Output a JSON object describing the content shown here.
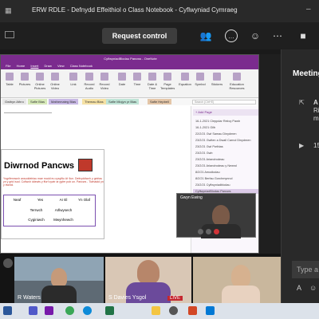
{
  "window": {
    "title": "ERW RDLE - Defnydd Effeithiol o Class Notebook - Cyflwyniad Cymraeg"
  },
  "meeting_bar": {
    "request_control_label": "Request control"
  },
  "onenote": {
    "title_bar": "CyflwyniadBlodau Pancws - OneNote",
    "menu_tabs": [
      "File",
      "Home",
      "Insert",
      "Draw",
      "View",
      "Class Notebook"
    ],
    "ribbon_items": [
      "Table",
      "Pictures",
      "Online Pictures",
      "Online Video",
      "Link",
      "Record Audio",
      "Record Video",
      "Date",
      "Time",
      "Date & Time",
      "Page Templates",
      "Equation",
      "Symbol",
      "Stickers",
      "Education Resources"
    ],
    "section_tabs": [
      "Gwibyn Athro",
      "Safle Blas",
      "Mathemateg Blas",
      "Themau Blas",
      "Safle Mlojyn yr Blas",
      "Safle Hepbell"
    ],
    "search_placeholder": "Search (Ctrl+E)",
    "add_page_label": "+ Add Page",
    "pages": [
      "16-1-2021 Cleppdar Rekvy Pawb",
      "16-1-2021 Gilb",
      "22/2/21 Gwl Samau Dinydmen",
      "23/2/21 Gwlten a Dwall Carnol Dinydmen",
      "23/2/21 Gwl Pwthias",
      "23/2/21 Gwb",
      "23/2/21 Ariandrodeau",
      "23/2/21 Ariandrodeau y Newrol",
      "8/2/21 Amodiodau",
      "8/2/21 Berfau Gorchmynnol",
      "23/2/21 Cyflwyniadblodau",
      "CyflwyniadBlodau Pancws"
    ],
    "doc_heading": "Diwrnod Pancws",
    "doc_text": "Ysgrifennwch ansoddeiriau mae modd eu cysylltu â'r llun. Defnyddiwch y geiriau yn y grid isod. Cofiwch ddewis y ffurf cywir ar gyfer pob un. Pancws - Tiwhaidd yn y bwrdd.",
    "grid": {
      "headers": [
        "",
        "Neaf",
        "Yes",
        "Ar El",
        "Yn Olaf"
      ],
      "rows": [
        [
          "",
          "Terrwch",
          "Arllwysech",
          ""
        ],
        [
          "",
          "Cyginiwch",
          "Mwynhewch",
          ""
        ]
      ]
    }
  },
  "presenter_inset": {
    "name": "Gwyn Ewing"
  },
  "side_panel": {
    "title": "Meeting",
    "items": [
      "A",
      "Ri",
      "m",
      "15"
    ]
  },
  "type_box": {
    "placeholder": "Type a"
  },
  "participants": [
    {
      "name": "R Waters",
      "live": ""
    },
    {
      "name": "S Davies Ysgol",
      "live": "LIVE"
    },
    {
      "name": "",
      "live": ""
    }
  ],
  "taskbar": {
    "icons": [
      "word-icon",
      "teams-icon",
      "onenote-icon",
      "chrome-icon",
      "edge-icon",
      "excel-icon",
      "explorer-icon",
      "settings-icon",
      "powerpoint-icon",
      "mail-icon"
    ]
  },
  "colors": {
    "onenote_purple": "#7b2b8e",
    "live_red": "#c4262e"
  }
}
